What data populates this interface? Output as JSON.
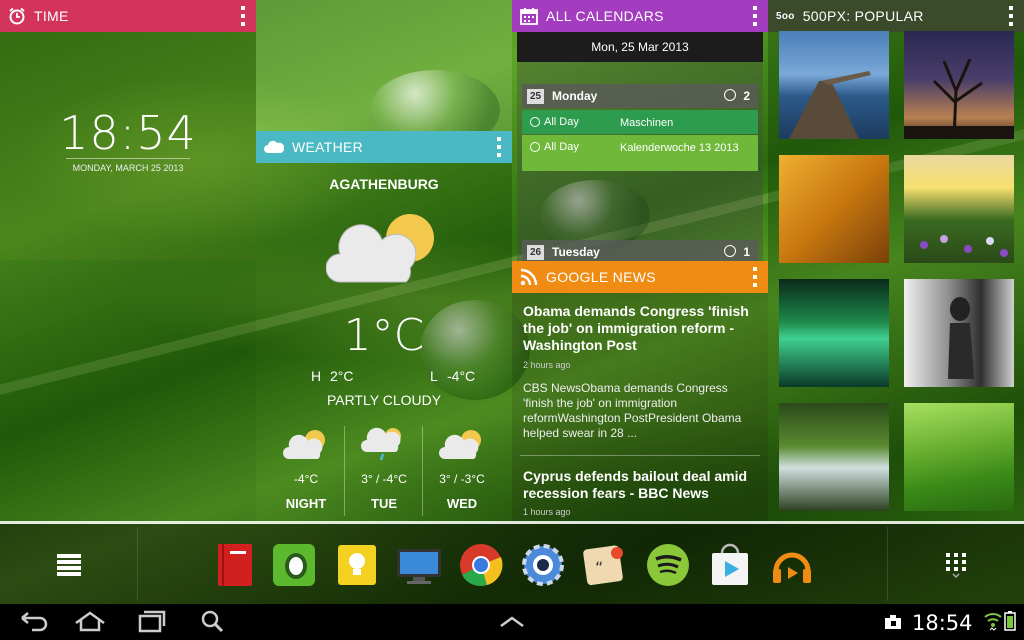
{
  "time_widget": {
    "title": "TIME",
    "clock": "18:54",
    "date": "MONDAY, MARCH 25 2013"
  },
  "weather_widget": {
    "title": "WEATHER",
    "city": "AGATHENBURG",
    "temperature": "1°C",
    "high_label": "H",
    "high": "2°C",
    "low_label": "L",
    "low": "-4°C",
    "condition": "PARTLY CLOUDY",
    "forecast": [
      {
        "temp": "-4°C",
        "day": "NIGHT",
        "icon": "partly-cloudy-icon"
      },
      {
        "temp": "3° / -4°C",
        "day": "TUE",
        "icon": "cloud-rain-icon"
      },
      {
        "temp": "3° / -3°C",
        "day": "WED",
        "icon": "partly-cloudy-icon"
      }
    ]
  },
  "calendar_widget": {
    "title": "ALL CALENDARS",
    "date_header": "Mon, 25 Mar 2013",
    "days": [
      {
        "num": "25",
        "name": "Monday",
        "count": "2"
      },
      {
        "num": "26",
        "name": "Tuesday",
        "count": "1"
      }
    ],
    "events": [
      {
        "when": "All Day",
        "what": "Maschinen",
        "color": "#2e9c4e"
      },
      {
        "when": "All Day",
        "what": "Kalenderwoche 13 2013",
        "color": "#6fb83a"
      }
    ]
  },
  "news_widget": {
    "title": "GOOGLE NEWS",
    "items": [
      {
        "headline": "Obama demands Congress 'finish the job' on immigration reform - Washington Post",
        "time": "2 hours ago",
        "snippet": "CBS NewsObama demands Congress 'finish the job' on immigration reformWashington PostPresident Obama helped swear in 28 ..."
      },
      {
        "headline": "Cyprus defends bailout deal amid recession fears - BBC News",
        "time": "1 hours ago"
      }
    ]
  },
  "px_widget": {
    "title": "500PX: POPULAR",
    "logo_text": "5oo",
    "photos": [
      "pier-photo",
      "night-tree-photo",
      "wheat-photo",
      "flower-meadow-photo",
      "aurora-photo",
      "bw-portrait-photo",
      "waterfall-photo",
      "green-hills-photo"
    ]
  },
  "dock": {
    "apps": [
      "book-app-icon",
      "evernote-icon",
      "keep-icon",
      "tv-icon",
      "chrome-icon",
      "settings-icon",
      "quotes-app-icon",
      "spotify-icon",
      "play-store-icon",
      "play-music-icon"
    ]
  },
  "system_bar": {
    "clock": "18:54"
  },
  "colors": {
    "time_accent": "#d2345c",
    "weather_accent": "#4ab9c4",
    "calendar_accent": "#a43cc0",
    "news_accent": "#f08c14"
  }
}
